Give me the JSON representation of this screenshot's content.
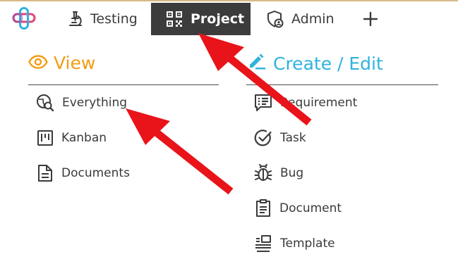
{
  "nav": {
    "testing_label": "Testing",
    "project_label": "Project",
    "admin_label": "Admin",
    "add_icon": "plus-icon"
  },
  "view_section": {
    "title": "View",
    "color": "#f39c12",
    "items": [
      {
        "label": "Everything",
        "icon": "globe-search-icon"
      },
      {
        "label": "Kanban",
        "icon": "kanban-icon"
      },
      {
        "label": "Documents",
        "icon": "document-icon"
      }
    ]
  },
  "create_section": {
    "title": "Create / Edit",
    "color": "#2fb3dc",
    "items": [
      {
        "label": "Requirement",
        "icon": "requirement-icon"
      },
      {
        "label": "Task",
        "icon": "check-circle-icon"
      },
      {
        "label": "Bug",
        "icon": "bug-icon"
      },
      {
        "label": "Document",
        "icon": "clipboard-icon"
      },
      {
        "label": "Template",
        "icon": "template-icon"
      }
    ]
  },
  "colors": {
    "active_tab_bg": "#3c3c3c",
    "annotation_arrow": "#e8141a"
  }
}
